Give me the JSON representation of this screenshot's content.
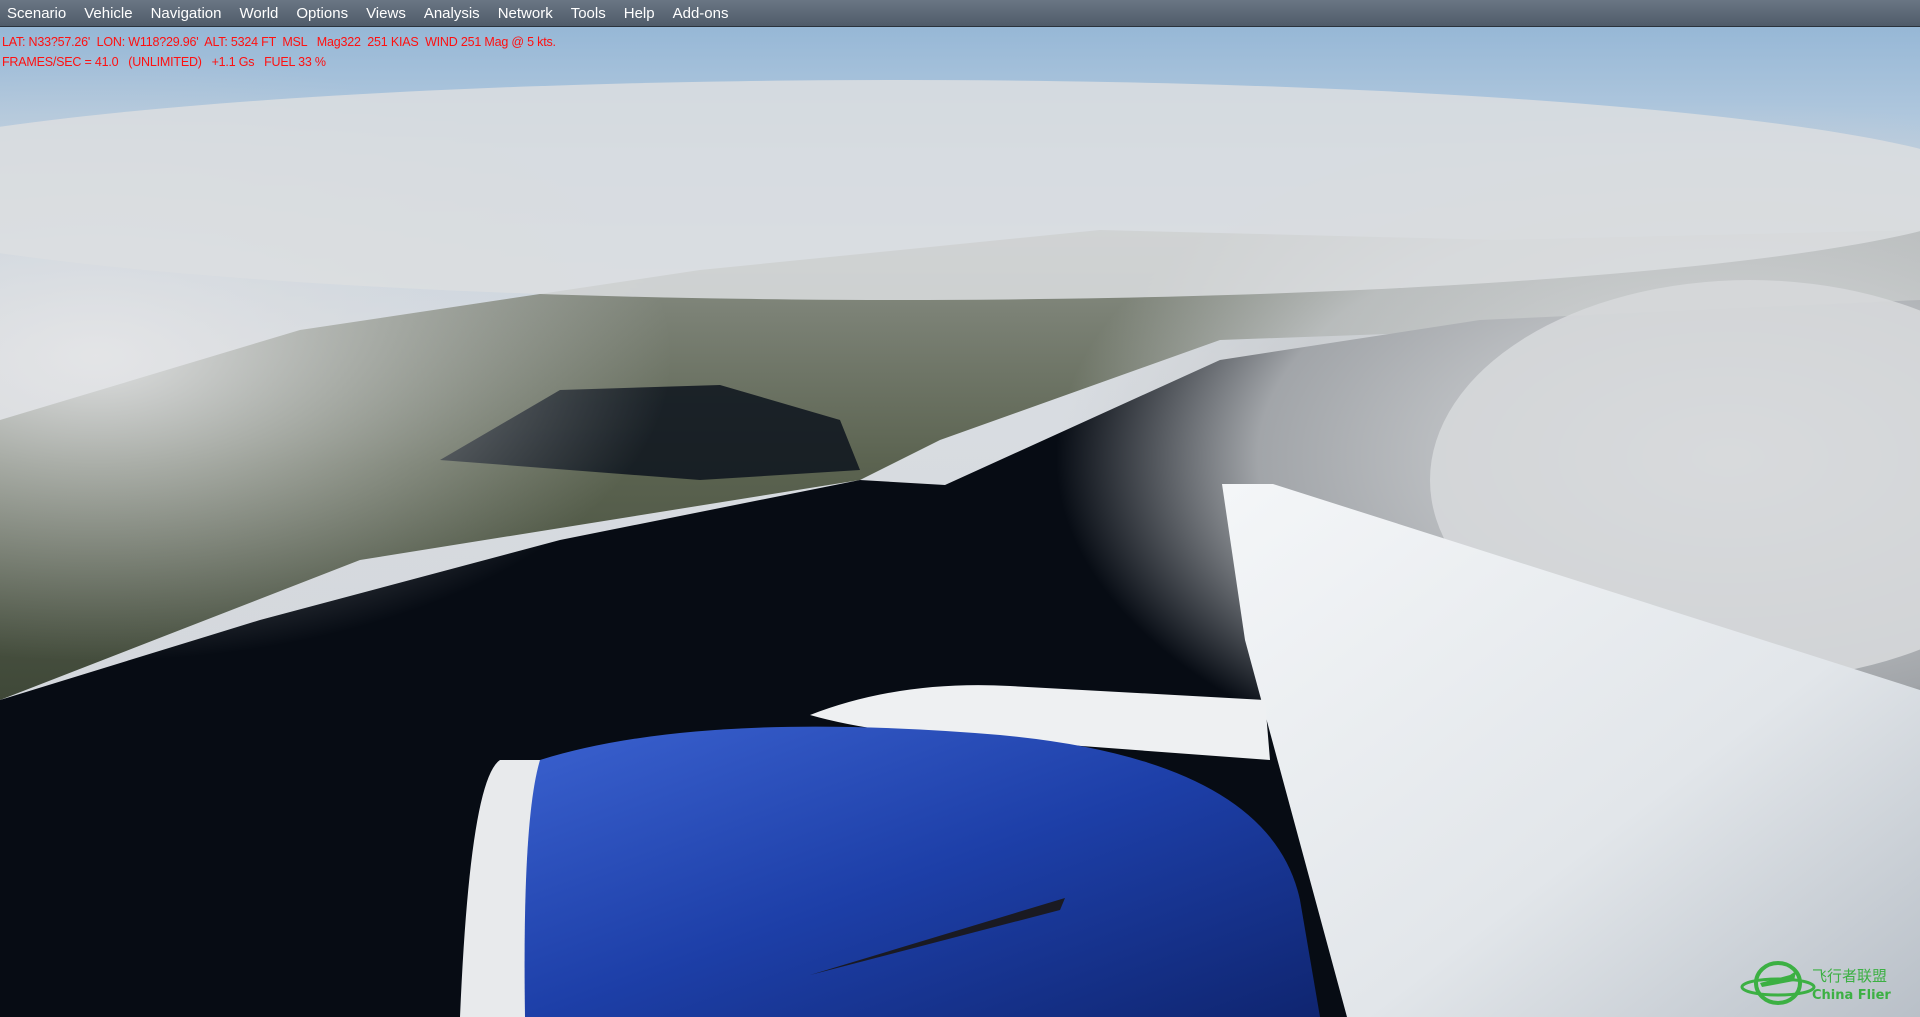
{
  "menu": {
    "items": [
      {
        "label": "Scenario"
      },
      {
        "label": "Vehicle"
      },
      {
        "label": "Navigation"
      },
      {
        "label": "World"
      },
      {
        "label": "Options"
      },
      {
        "label": "Views"
      },
      {
        "label": "Analysis"
      },
      {
        "label": "Network"
      },
      {
        "label": "Tools"
      },
      {
        "label": "Help"
      },
      {
        "label": "Add-ons"
      }
    ]
  },
  "hud": {
    "line1": "LAT: N33?57.26'  LON: W118?29.96'  ALT: 5324 FT  MSL   Mag322  251 KIAS  WIND 251 Mag @ 5 kts.",
    "line2": "FRAMES/SEC = 41.0   (UNLIMITED)   +1.1 Gs   FUEL 33 %",
    "color": "#ff1010"
  },
  "watermark": {
    "text_cn": "飞行者联盟",
    "text_en": "China Flier",
    "color": "#3cb043"
  },
  "scene": {
    "engine_color": "#1d3fa8",
    "water_color": "#070c14"
  }
}
